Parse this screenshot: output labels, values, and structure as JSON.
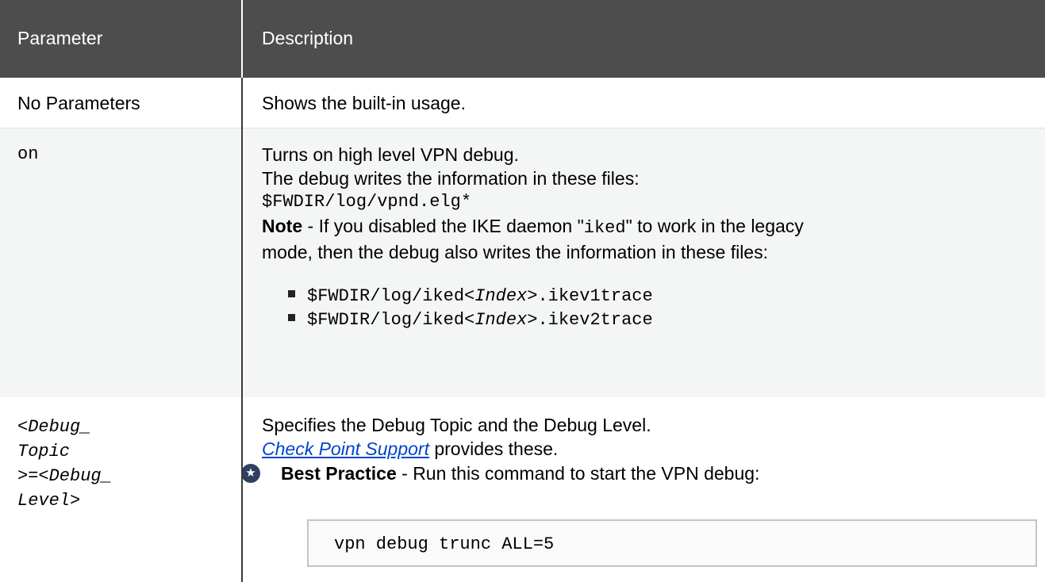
{
  "header": {
    "col_parameter": "Parameter",
    "col_description": "Description"
  },
  "rows": {
    "no_params": {
      "param": "No Parameters",
      "desc": "Shows the built-in usage."
    },
    "on": {
      "param": "on",
      "line1": "Turns on high level VPN debug.",
      "line2": "The debug writes the information in these files:",
      "file": "$FWDIR/log/vpnd.elg*",
      "note_label": "Note",
      "note_a": " - If you disabled the IKE daemon \"",
      "note_code": "iked",
      "note_b": "\" to work in the legacy",
      "note_line2": "mode, then the debug also writes the information in these files:",
      "bullets": [
        {
          "pre": "$FWDIR/log/iked<",
          "ital": "Index",
          "post": ">.ikev1trace"
        },
        {
          "pre": "$FWDIR/log/iked<",
          "ital": "Index",
          "post": ">.ikev2trace"
        }
      ]
    },
    "debug_topic": {
      "param_lines": [
        "<Debug_",
        "Topic",
        ">=<Debug_",
        "Level>"
      ],
      "line1": "Specifies the Debug Topic and the Debug Level.",
      "link_text": "Check Point Support",
      "link_suffix": " provides these.",
      "bp_label": "Best Practice",
      "bp_text": " - Run this command to start the VPN debug:",
      "command": "vpn debug trunc ALL=5"
    }
  },
  "colors": {
    "header_bg": "#4d4d4d",
    "alt_row_bg": "#f4f5f5",
    "link": "#0044cc",
    "bp_icon_bg": "#2f3f63"
  },
  "icons": {
    "best_practice": "star-badge-icon",
    "bullet": "square-bullet-icon"
  }
}
